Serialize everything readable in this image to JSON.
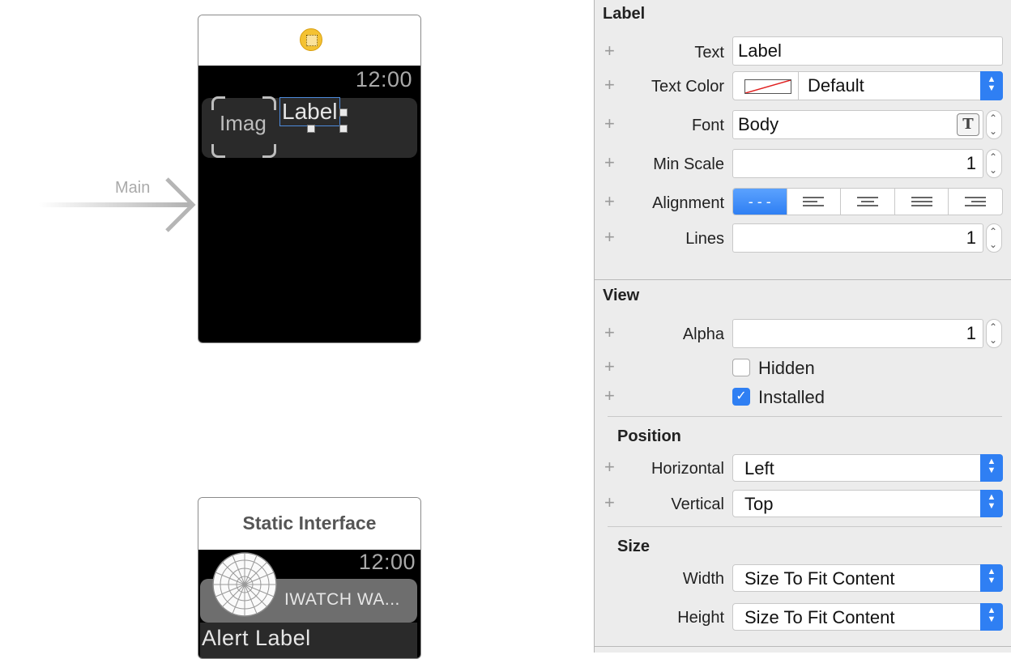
{
  "canvas": {
    "entry_arrow_label": "Main",
    "main_interface": {
      "time": "12:00",
      "image_placeholder": "Imag",
      "selected_label": "Label"
    },
    "static_interface": {
      "title": "Static Interface",
      "time": "12:00",
      "app_name": "IWATCH WA...",
      "alert_label": "Alert Label"
    }
  },
  "inspector": {
    "label_section": {
      "title": "Label",
      "text_label": "Text",
      "text_value": "Label",
      "text_color_label": "Text Color",
      "text_color_value": "Default",
      "font_label": "Font",
      "font_value": "Body",
      "min_scale_label": "Min Scale",
      "min_scale_value": "1",
      "alignment_label": "Alignment",
      "lines_label": "Lines",
      "lines_value": "1"
    },
    "view_section": {
      "title": "View",
      "alpha_label": "Alpha",
      "alpha_value": "1",
      "hidden_label": "Hidden",
      "installed_label": "Installed"
    },
    "position_section": {
      "title": "Position",
      "horizontal_label": "Horizontal",
      "horizontal_value": "Left",
      "vertical_label": "Vertical",
      "vertical_value": "Top"
    },
    "size_section": {
      "title": "Size",
      "width_label": "Width",
      "width_value": "Size To Fit Content",
      "height_label": "Height",
      "height_value": "Size To Fit Content"
    }
  },
  "colors": {
    "accent": "#2f7ff3",
    "inspector_bg": "#ececec",
    "screen_bg": "#000000"
  }
}
